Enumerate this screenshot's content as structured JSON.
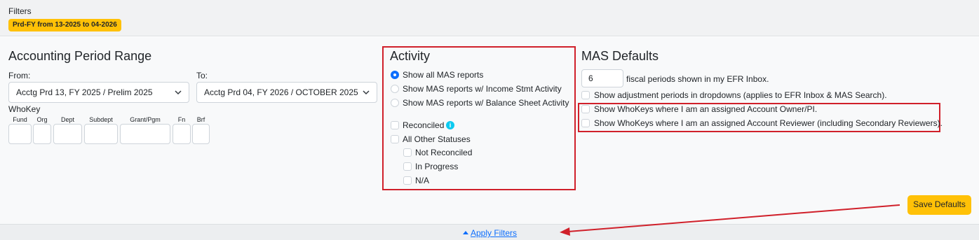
{
  "filters": {
    "title": "Filters",
    "badge": "Prd-FY from 13-2025 to 04-2026"
  },
  "period": {
    "heading": "Accounting Period Range",
    "from_label": "From:",
    "from_value": "Acctg Prd 13, FY 2025 / Prelim 2025",
    "to_label": "To:",
    "to_value": "Acctg Prd 04, FY 2026 / OCTOBER 2025",
    "whokey_label": "WhoKey",
    "whokey_fields": [
      "Fund",
      "Org",
      "Dept",
      "Subdept",
      "Grant/Pgm",
      "Fn",
      "Brf"
    ]
  },
  "activity": {
    "heading": "Activity",
    "radios": [
      {
        "label": "Show all MAS reports",
        "selected": true
      },
      {
        "label": "Show MAS reports w/ Income Stmt Activity",
        "selected": false
      },
      {
        "label": "Show MAS reports w/ Balance Sheet Activity",
        "selected": false
      }
    ],
    "reconciled_label": "Reconciled",
    "all_other_label": "All Other Statuses",
    "sub_statuses": [
      "Not Reconciled",
      "In Progress",
      "N/A"
    ]
  },
  "mas_defaults": {
    "heading": "MAS Defaults",
    "periods_value": "6",
    "periods_label": "fiscal periods shown in my EFR Inbox.",
    "checks": [
      "Show adjustment periods in dropdowns (applies to EFR Inbox & MAS Search).",
      "Show WhoKeys where I am an assigned Account Owner/PI.",
      "Show WhoKeys where I am an assigned Account Reviewer (including Secondary Reviewers)."
    ],
    "save_label": "Save Defaults"
  },
  "footer": {
    "apply_label": "Apply Filters"
  },
  "colors": {
    "accent_yellow": "#ffc107",
    "link_blue": "#0d6efd",
    "annotation_red": "#d0202a"
  }
}
